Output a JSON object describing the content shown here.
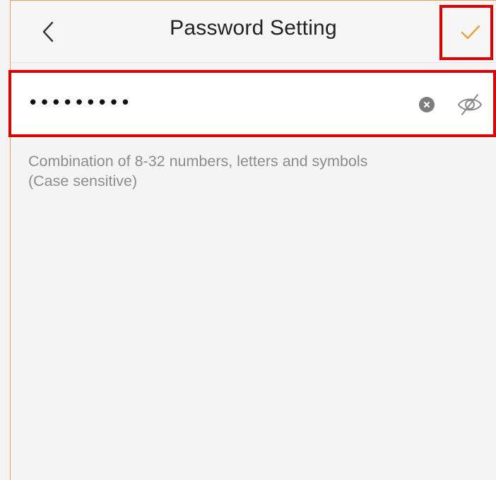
{
  "header": {
    "title": "Password Setting",
    "back_icon": "chevron-left-icon",
    "confirm_icon": "checkmark-icon"
  },
  "password_field": {
    "value": "•••••••••",
    "clear_icon": "clear-circle-icon",
    "visibility_icon": "eye-hidden-icon"
  },
  "hint": {
    "line1": "Combination of 8-32 numbers, letters and symbols",
    "line2": "(Case sensitive)"
  },
  "colors": {
    "accent": "#f0a030",
    "highlight": "#e00000",
    "hint_text": "#8c8c8c",
    "background": "#f4f4f4"
  }
}
